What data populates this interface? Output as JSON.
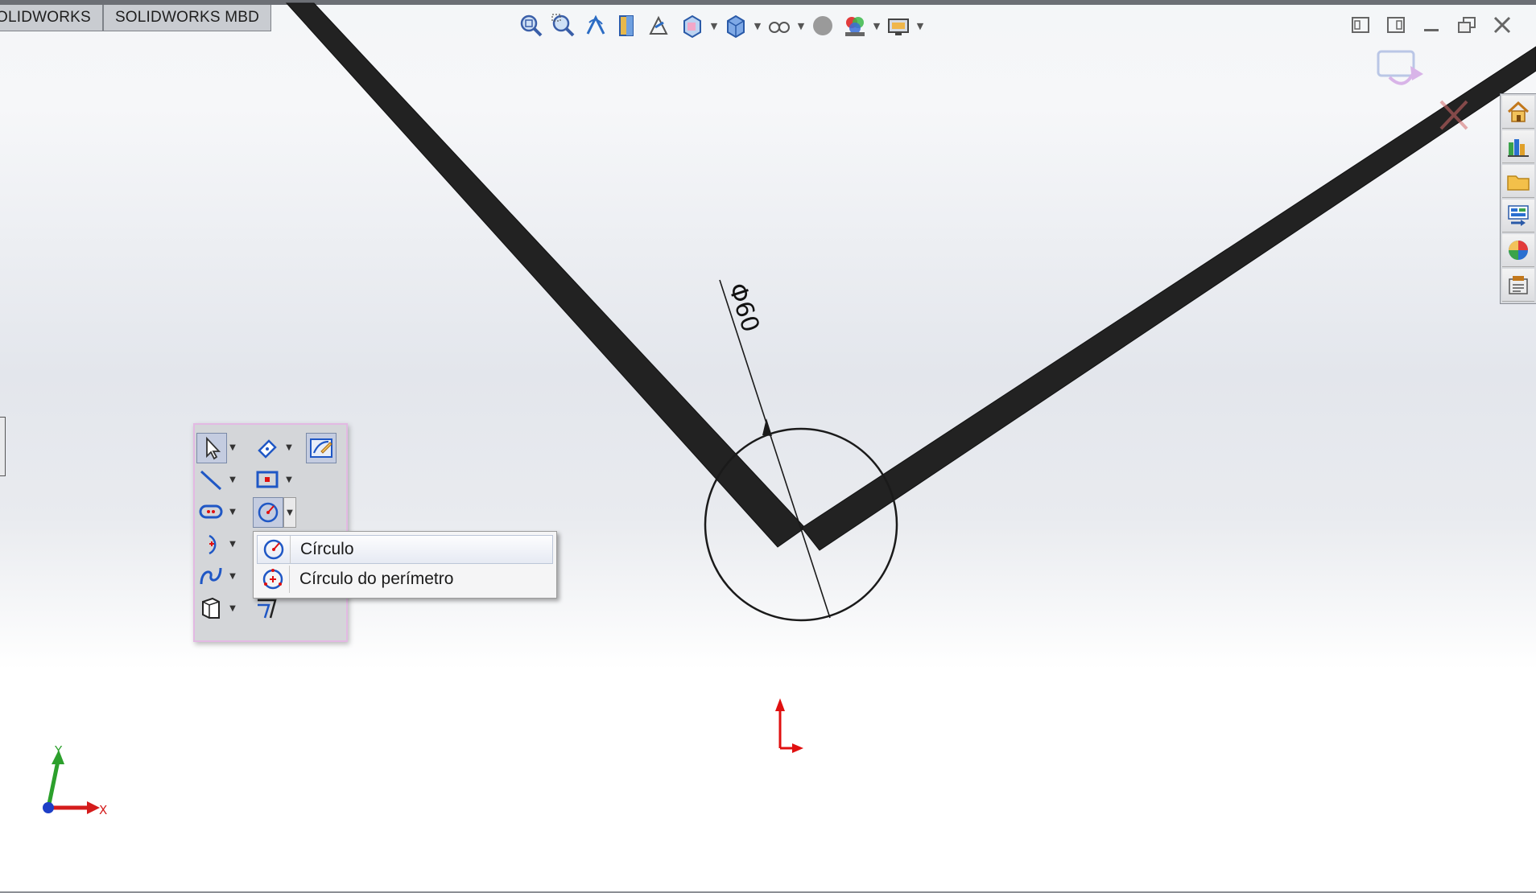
{
  "tabs": [
    "OLIDWORKS",
    "SOLIDWORKS MBD"
  ],
  "sketch": {
    "dimension_label": "Φ60",
    "triad": {
      "x_label": "X",
      "y_label": "Y"
    }
  },
  "heads_up_toolbar": {
    "icons": [
      "zoom-to-fit-icon",
      "zoom-to-area-icon",
      "previous-view-icon",
      "section-view-icon",
      "dynamic-annotation-icon",
      "view-orientation-icon",
      "display-style-icon",
      "hide-show-items-icon",
      "edit-appearance-icon",
      "apply-scene-icon",
      "view-settings-icon"
    ]
  },
  "window_controls": [
    "tile-left-icon",
    "tile-right-icon",
    "minimize-icon",
    "restore-icon",
    "close-icon"
  ],
  "task_pane": [
    "home-icon",
    "design-library-icon",
    "file-explorer-icon",
    "view-palette-icon",
    "appearances-icon",
    "custom-properties-icon"
  ],
  "shortcut_bar": {
    "tools": [
      "select",
      "smart-dimension",
      "sketch",
      "line",
      "rectangle",
      "slot",
      "circle",
      "arc",
      "spline",
      "plane",
      "offset-entities"
    ]
  },
  "flyout": {
    "items": [
      {
        "label": "Círculo",
        "icon": "circle-icon",
        "highlighted": true
      },
      {
        "label": "Círculo do perímetro",
        "icon": "perimeter-circle-icon",
        "highlighted": false
      }
    ]
  },
  "colors": {
    "sketch_line": "#1a1a1a",
    "beam_fill": "#222222",
    "origin_red": "#e01010",
    "accent_blue": "#1f57c5",
    "flyout_border": "#e3b9e3"
  }
}
